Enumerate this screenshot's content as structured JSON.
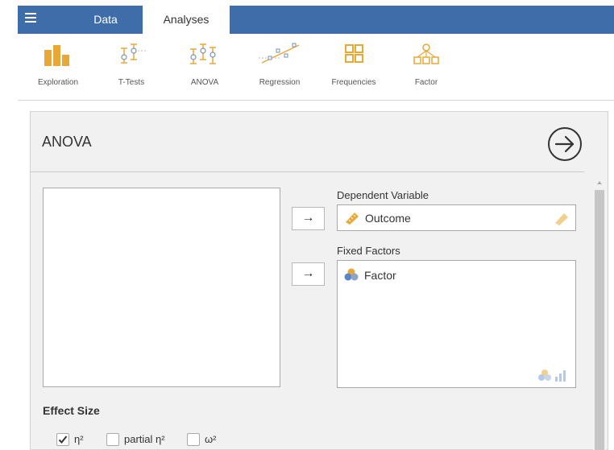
{
  "tabs": {
    "data_label": "Data",
    "analyses_label": "Analyses"
  },
  "ribbon": {
    "items": [
      {
        "label": "Exploration",
        "icon": "exploration-icon"
      },
      {
        "label": "T-Tests",
        "icon": "t-tests-icon"
      },
      {
        "label": "ANOVA",
        "icon": "anova-icon"
      },
      {
        "label": "Regression",
        "icon": "regression-icon"
      },
      {
        "label": "Frequencies",
        "icon": "frequencies-icon"
      },
      {
        "label": "Factor",
        "icon": "factor-icon"
      }
    ]
  },
  "panel": {
    "title": "ANOVA",
    "dependent_label": "Dependent Variable",
    "dependent_value": "Outcome",
    "fixed_label": "Fixed Factors",
    "fixed_value": "Factor",
    "arrow": "→",
    "effect_size_title": "Effect Size",
    "options": [
      {
        "label": "η²",
        "checked": true
      },
      {
        "label": "partial η²",
        "checked": false
      },
      {
        "label": "ω²",
        "checked": false
      }
    ]
  },
  "colors": {
    "topbar": "#3e6da9",
    "ribbon_icon": "#e8a835",
    "panel_bg": "#f1f1f1"
  }
}
